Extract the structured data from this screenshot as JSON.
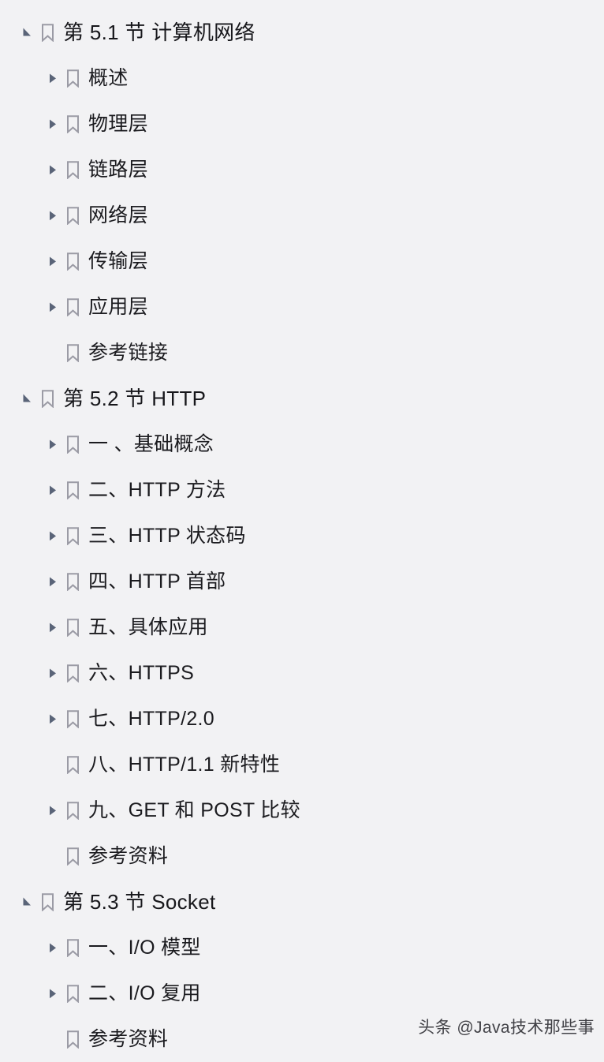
{
  "panel": {
    "kind": "pdf-bookmark-outline",
    "background_color": "#f2f2f4",
    "text_color": "#1b1b1f",
    "twisty_color": "#5a6478",
    "bookmark_icon_color": "#9b9ba5"
  },
  "outline": {
    "items": [
      {
        "label": "第 5.1 节 计算机网络",
        "level": 0,
        "state": "expanded",
        "icon": "bookmark-icon"
      },
      {
        "label": "概述",
        "level": 1,
        "state": "collapsed",
        "icon": "bookmark-icon"
      },
      {
        "label": "物理层",
        "level": 1,
        "state": "collapsed",
        "icon": "bookmark-icon"
      },
      {
        "label": "链路层",
        "level": 1,
        "state": "collapsed",
        "icon": "bookmark-icon"
      },
      {
        "label": "网络层",
        "level": 1,
        "state": "collapsed",
        "icon": "bookmark-icon"
      },
      {
        "label": "传输层",
        "level": 1,
        "state": "collapsed",
        "icon": "bookmark-icon"
      },
      {
        "label": "应用层",
        "level": 1,
        "state": "collapsed",
        "icon": "bookmark-icon"
      },
      {
        "label": "参考链接",
        "level": 1,
        "state": "leaf",
        "icon": "bookmark-icon"
      },
      {
        "label": "第 5.2 节 HTTP",
        "level": 0,
        "state": "expanded",
        "icon": "bookmark-icon"
      },
      {
        "label": "一 、基础概念",
        "level": 1,
        "state": "collapsed",
        "icon": "bookmark-icon"
      },
      {
        "label": "二、HTTP 方法",
        "level": 1,
        "state": "collapsed",
        "icon": "bookmark-icon"
      },
      {
        "label": "三、HTTP 状态码",
        "level": 1,
        "state": "collapsed",
        "icon": "bookmark-icon"
      },
      {
        "label": "四、HTTP 首部",
        "level": 1,
        "state": "collapsed",
        "icon": "bookmark-icon"
      },
      {
        "label": "五、具体应用",
        "level": 1,
        "state": "collapsed",
        "icon": "bookmark-icon"
      },
      {
        "label": "六、HTTPS",
        "level": 1,
        "state": "collapsed",
        "icon": "bookmark-icon"
      },
      {
        "label": "七、HTTP/2.0",
        "level": 1,
        "state": "collapsed",
        "icon": "bookmark-icon"
      },
      {
        "label": "八、HTTP/1.1 新特性",
        "level": 1,
        "state": "leaf",
        "icon": "bookmark-icon"
      },
      {
        "label": "九、GET 和 POST 比较",
        "level": 1,
        "state": "collapsed",
        "icon": "bookmark-icon"
      },
      {
        "label": "参考资料",
        "level": 1,
        "state": "leaf",
        "icon": "bookmark-icon"
      },
      {
        "label": "第 5.3 节 Socket",
        "level": 0,
        "state": "expanded",
        "icon": "bookmark-icon"
      },
      {
        "label": "一、I/O 模型",
        "level": 1,
        "state": "collapsed",
        "icon": "bookmark-icon"
      },
      {
        "label": "二、I/O 复用",
        "level": 1,
        "state": "collapsed",
        "icon": "bookmark-icon"
      },
      {
        "label": "参考资料",
        "level": 1,
        "state": "leaf",
        "icon": "bookmark-icon"
      }
    ]
  },
  "watermark": {
    "text": "头条 @Java技术那些事"
  }
}
